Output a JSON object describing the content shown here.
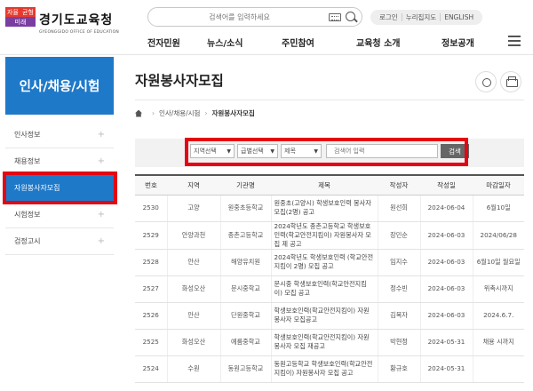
{
  "header": {
    "logo_mark": [
      "자율",
      "균형",
      "미래"
    ],
    "logo_ko": "경기도교육청",
    "logo_en": "GYEONGGIDO OFFICE OF EDUCATION",
    "search_placeholder": "검색어를 입력하세요",
    "top_links": [
      "로그인",
      "누리집지도",
      "ENGLISH"
    ],
    "gnb": [
      "전자민원",
      "뉴스/소식",
      "주민참여",
      "교육청 소개",
      "정보공개"
    ]
  },
  "sidebar": {
    "title": "인사/채용/시험",
    "items": [
      {
        "label": "인사정보",
        "plus": "+"
      },
      {
        "label": "채용정보",
        "plus": "+"
      },
      {
        "label": "자원봉사자모집",
        "plus": ""
      },
      {
        "label": "시험정보",
        "plus": "+"
      },
      {
        "label": "검정고시",
        "plus": "+"
      }
    ]
  },
  "page": {
    "title": "자원봉사자모집",
    "breadcrumb": [
      "인사/채용/시험",
      "자원봉사자모집"
    ]
  },
  "filter": {
    "region": "지역선택",
    "level": "급별선택",
    "field": "제목",
    "keyword_placeholder": "검색어 입력",
    "search_label": "검색"
  },
  "table": {
    "headers": [
      "번호",
      "지역",
      "기관명",
      "제목",
      "작성자",
      "작성일",
      "마감일자"
    ],
    "rows": [
      [
        "2530",
        "고양",
        "원중초등학교",
        "원중초(고양시) 학생보호인력 봉사자 모집(2명) 공고",
        "원선희",
        "2024-06-04",
        "6월10일"
      ],
      [
        "2529",
        "안양과천",
        "종촌고등학교",
        "2024학년도 종촌고등학교 학생보호인력(학교안전지킴이) 자원봉사자 모집 제 공고",
        "장민순",
        "2024-06-03",
        "2024/06/28"
      ],
      [
        "2528",
        "안산",
        "해양유치원",
        "2024학년도 학생보호인력 (학교안전지킴이 2명) 모집 공고",
        "임지수",
        "2024-06-03",
        "6월10일 월요일"
      ],
      [
        "2527",
        "화성오산",
        "문시중학교",
        "문시중 학생보호인력(학교안전지킴이) 모집 공고",
        "정수빈",
        "2024-06-03",
        "위촉시까지"
      ],
      [
        "2526",
        "안산",
        "단원중학교",
        "학생보호인력(학교안전지킴이) 자원봉사자 모집공고",
        "김복자",
        "2024-06-03",
        "2024.6.7."
      ],
      [
        "2525",
        "화성오산",
        "예룸중학교",
        "학생보호인력(학교안전지킴이) 자원봉사자 모집 재공고",
        "박현정",
        "2024-05-31",
        "채용 시까지"
      ],
      [
        "2524",
        "수원",
        "동원고등학교",
        "동원고등학교 학생보호인력(학교안전지킴이) 자원봉사자 모집 공고",
        "황규호",
        "2024-05-31",
        ""
      ]
    ]
  }
}
